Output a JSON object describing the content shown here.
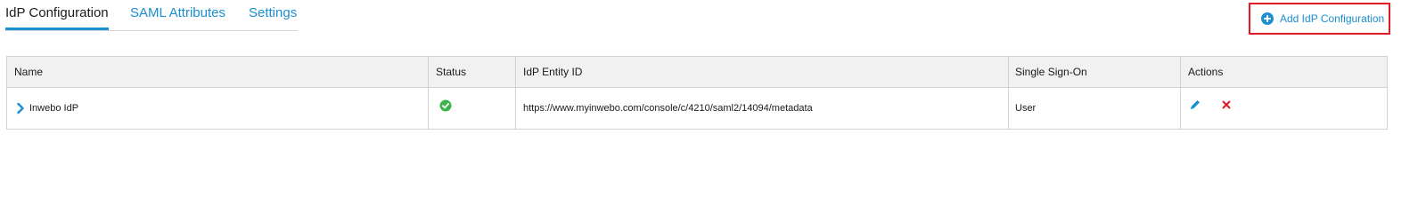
{
  "tabs": [
    {
      "label": "IdP Configuration",
      "active": true
    },
    {
      "label": "SAML Attributes",
      "active": false
    },
    {
      "label": "Settings",
      "active": false
    }
  ],
  "add_button": {
    "label": "Add IdP Configuration",
    "icon": "plus-circle-icon"
  },
  "table": {
    "headers": {
      "name": "Name",
      "status": "Status",
      "entity_id": "IdP Entity ID",
      "sso": "Single Sign-On",
      "actions": "Actions"
    },
    "rows": [
      {
        "name": "Inwebo IdP",
        "status": "active",
        "entity_id": "https://www.myinwebo.com/console/c/4210/saml2/14094/metadata",
        "sso": "User",
        "actions": [
          "pencil-icon",
          "close-icon"
        ]
      }
    ]
  },
  "colors": {
    "accent": "#1a8fd1",
    "status_ok": "#3cb34a",
    "delete": "#e01b24",
    "highlight_border": "#e01b24",
    "header_bg": "#f1f1f1"
  }
}
